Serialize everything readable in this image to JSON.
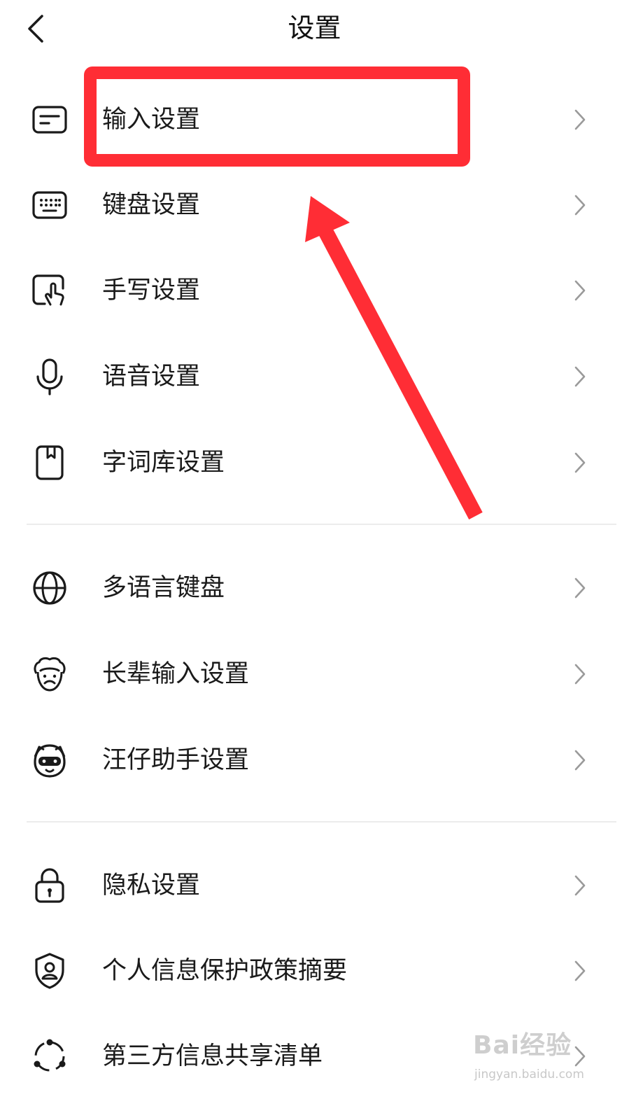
{
  "header": {
    "title": "设置",
    "back_icon": "chevron-left-icon"
  },
  "sections": [
    {
      "items": [
        {
          "label": "输入设置",
          "icon": "input-card-icon"
        },
        {
          "label": "键盘设置",
          "icon": "keyboard-icon"
        },
        {
          "label": "手写设置",
          "icon": "handwriting-icon"
        },
        {
          "label": "语音设置",
          "icon": "microphone-icon"
        },
        {
          "label": "字词库设置",
          "icon": "dictionary-book-icon"
        }
      ]
    },
    {
      "items": [
        {
          "label": "多语言键盘",
          "icon": "globe-icon"
        },
        {
          "label": "长辈输入设置",
          "icon": "elder-face-icon"
        },
        {
          "label": "汪仔助手设置",
          "icon": "dog-assistant-icon"
        }
      ]
    },
    {
      "items": [
        {
          "label": "隐私设置",
          "icon": "lock-icon"
        },
        {
          "label": "个人信息保护政策摘要",
          "icon": "shield-user-icon"
        },
        {
          "label": "第三方信息共享清单",
          "icon": "share-nodes-icon"
        }
      ]
    }
  ],
  "annotation": {
    "color": "#ff2d35",
    "highlighted_item": "输入设置"
  },
  "watermark": {
    "main": "Bai经验",
    "sub": "jingyan.baidu.com"
  }
}
